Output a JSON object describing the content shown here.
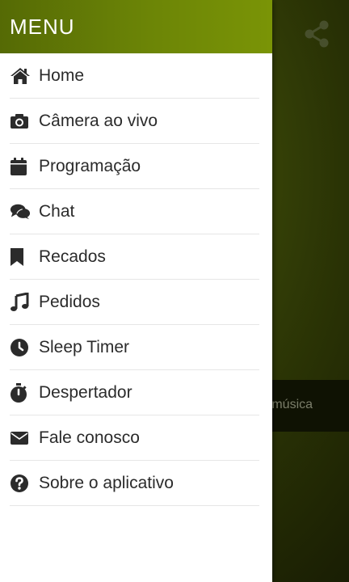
{
  "background": {
    "share_icon": "share-icon",
    "now_playing_text": "a música"
  },
  "drawer": {
    "title": "MENU",
    "items": [
      {
        "label": "Home",
        "icon": "home-icon"
      },
      {
        "label": "Câmera ao vivo",
        "icon": "camera-icon"
      },
      {
        "label": "Programação",
        "icon": "calendar-icon"
      },
      {
        "label": "Chat",
        "icon": "chat-bubbles-icon"
      },
      {
        "label": "Recados",
        "icon": "bookmark-icon"
      },
      {
        "label": "Pedidos",
        "icon": "music-note-icon"
      },
      {
        "label": "Sleep Timer",
        "icon": "clock-icon"
      },
      {
        "label": "Despertador",
        "icon": "stopwatch-icon"
      },
      {
        "label": "Fale conosco",
        "icon": "envelope-icon"
      },
      {
        "label": "Sobre o aplicativo",
        "icon": "question-circle-icon"
      }
    ]
  },
  "colors": {
    "header_green": "#6c8506",
    "icon_dark": "#2b2b2b",
    "drawer_bg": "#ffffff"
  }
}
